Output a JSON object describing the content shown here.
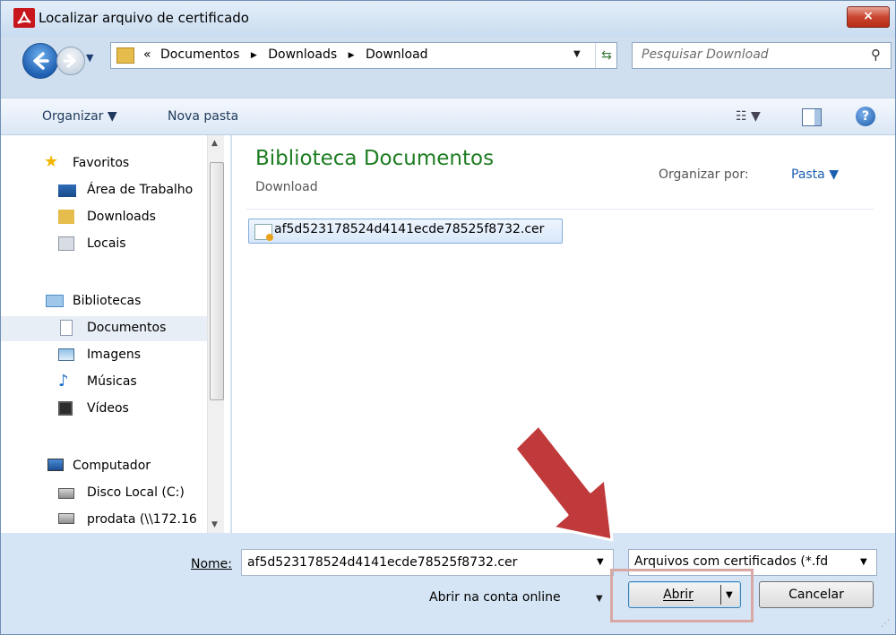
{
  "window": {
    "title": "Localizar arquivo de certificado",
    "close_label": "×"
  },
  "navigation": {
    "breadcrumb_prefix": "«",
    "breadcrumb": [
      "Documentos",
      "Downloads",
      "Download"
    ],
    "breadcrumb_separator": "▶",
    "search_placeholder": "Pesquisar Download"
  },
  "toolbar": {
    "organize_label": "Organizar ▼",
    "new_folder_label": "Nova pasta",
    "views_label": "☷ ▼",
    "help_label": "?"
  },
  "nav_pane": {
    "favorites": "Favoritos",
    "desktop": "Área de Trabalho",
    "downloads": "Downloads",
    "places": "Locais",
    "libraries": "Bibliotecas",
    "documents": "Documentos",
    "images": "Imagens",
    "music": "Músicas",
    "videos": "Vídeos",
    "computer": "Computador",
    "local_disk": "Disco Local (C:)",
    "network": "prodata (\\\\172.16"
  },
  "content": {
    "library_title": "Biblioteca Documentos",
    "library_subtitle": "Download",
    "arrange_label": "Organizar por:",
    "arrange_value": "Pasta ▼",
    "files": [
      {
        "name": "af5d523178524d4141ecde78525f8732.cer"
      }
    ]
  },
  "footer": {
    "name_label": "Nome:",
    "name_value": "af5d523178524d4141ecde78525f8732.cer",
    "filter_value": "Arquivos com certificados (*.fd",
    "online_label": "Abrir na conta online",
    "open_label": "Abrir",
    "cancel_label": "Cancelar"
  },
  "colors": {
    "title_bar": "#c9dcf0",
    "library_title": "#1e7d22",
    "arrow": "#c0393b",
    "highlight": "#d7a8a4"
  }
}
